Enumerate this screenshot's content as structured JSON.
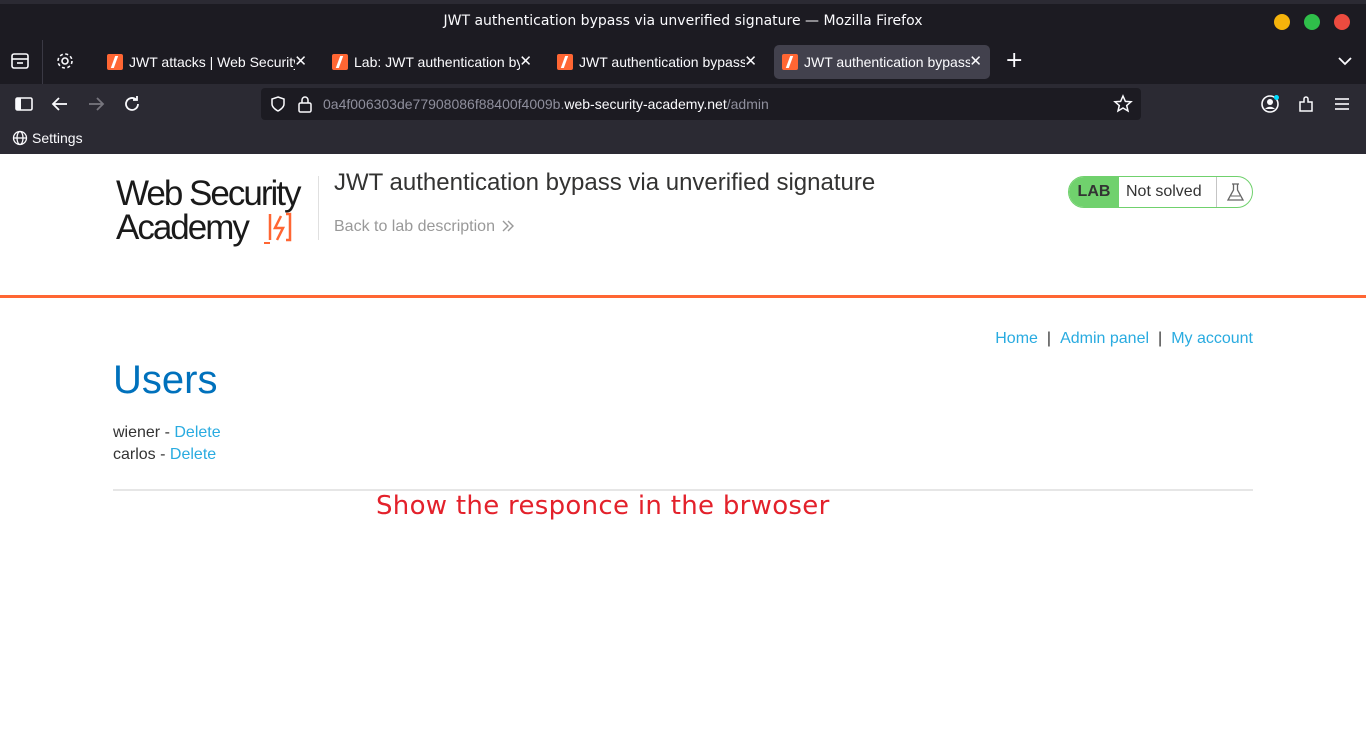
{
  "window": {
    "title": "JWT authentication bypass via unverified signature — Mozilla Firefox"
  },
  "tabs": [
    {
      "label": "JWT attacks | Web Security Academy",
      "active": false
    },
    {
      "label": "Lab: JWT authentication bypass via unverified signature",
      "active": false
    },
    {
      "label": "JWT authentication bypass via unverified signature",
      "active": false
    },
    {
      "label": "JWT authentication bypass via unverified signature",
      "active": true
    }
  ],
  "urlbar": {
    "prefix": "0a4f006303de77908086f88400f4009b.",
    "host": "web-security-academy.net",
    "path": "/admin"
  },
  "bookmarks": [
    {
      "label": "Settings",
      "icon": "globe-icon"
    }
  ],
  "header": {
    "logo_line1": "Web Security",
    "logo_line2": "Academy",
    "lab_title": "JWT authentication bypass via unverified signature",
    "back_link": "Back to lab description",
    "lab_badge": "LAB",
    "lab_status": "Not solved"
  },
  "topnav": {
    "home": "Home",
    "admin_panel": "Admin panel",
    "my_account": "My account",
    "separator": "|"
  },
  "main": {
    "heading": "Users",
    "users": [
      {
        "name": "wiener",
        "separator": " - ",
        "action": "Delete"
      },
      {
        "name": "carlos",
        "separator": " - ",
        "action": "Delete"
      }
    ]
  },
  "annotation": {
    "text": "Show the responce in the brwoser",
    "color": "#e3212b"
  },
  "colors": {
    "accent_orange": "#ff6633",
    "link_blue": "#29abe0",
    "heading_blue": "#0071bc",
    "lab_green": "#70d16d"
  }
}
